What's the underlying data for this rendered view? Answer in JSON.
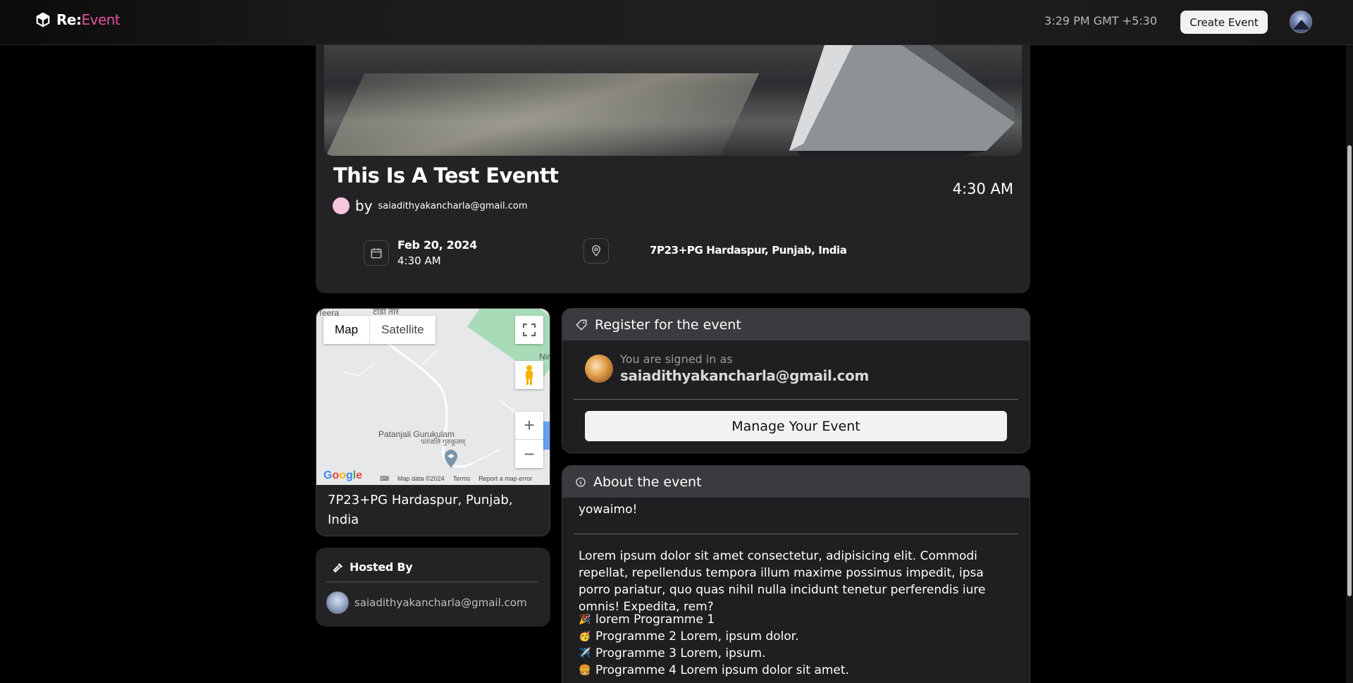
{
  "nav": {
    "brand_bold": "Re:",
    "brand_light": "Event",
    "time": "3:29 PM GMT +5:30",
    "create_label": "Create Event"
  },
  "event": {
    "title": "This Is A Test Eventt",
    "time": "4:30 AM",
    "by_word": "by",
    "organizer_email": "saiadithyakancharla@gmail.com",
    "date": "Feb 20, 2024",
    "date_time": "4:30 AM",
    "location": "7P23+PG Hardaspur, Punjab, India"
  },
  "map": {
    "type_map": "Map",
    "type_satellite": "Satellite",
    "label_teera": "Teera",
    "label_hindi_top": "टोडा तार",
    "label_ni": "Nir",
    "label_place": "Patanjali Gurukulam",
    "label_place_hindi": "पतंजलि गुरुकुलम्",
    "google": "Google",
    "map_data": "Map data ©2024",
    "terms": "Terms",
    "report": "Report a map error",
    "address": "7P23+PG Hardaspur, Punjab, India"
  },
  "host": {
    "heading": "Hosted By",
    "email": "saiadithyakancharla@gmail.com"
  },
  "register": {
    "heading": "Register for the event",
    "signed_in_label": "You are signed in as",
    "email": "saiadithyakancharla@gmail.com",
    "manage_label": "Manage Your Event"
  },
  "about": {
    "heading": "About the event",
    "greeting": "yowaimo!",
    "paragraph": "Lorem ipsum dolor sit amet consectetur, adipisicing elit. Commodi repellat, repellendus tempora illum maxime possimus impedit, ipsa porro pariatur, quo quas nihil nulla incidunt tenetur perferendis iure omnis! Expedita, rem?",
    "programmes": [
      {
        "emoji": "🎉",
        "text": "lorem Programme 1"
      },
      {
        "emoji": "🥳",
        "text": "Programme 2 Lorem, ipsum dolor."
      },
      {
        "emoji": "✈️",
        "text": "Programme 3 Lorem, ipsum."
      },
      {
        "emoji": "🍔",
        "text": "Programme 4 Lorem ipsum dolor sit amet."
      }
    ]
  }
}
